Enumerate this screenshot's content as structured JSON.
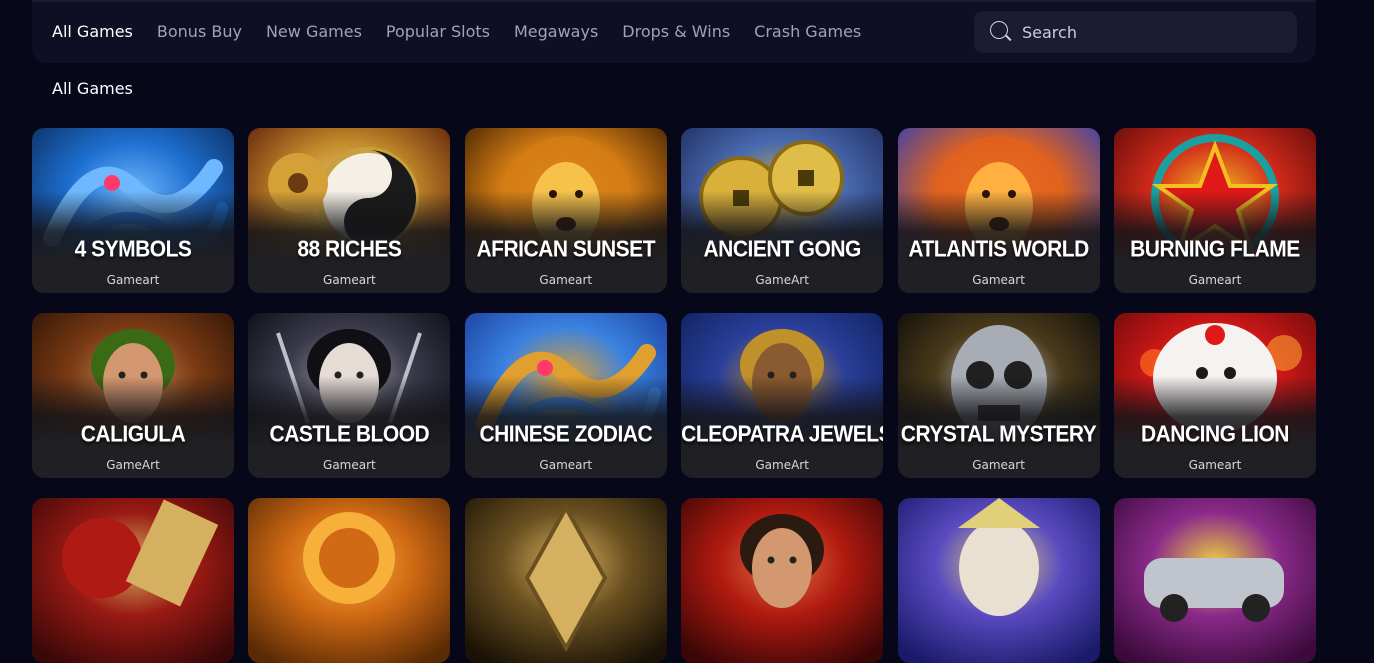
{
  "nav": {
    "items": [
      {
        "label": "All Games",
        "active": true
      },
      {
        "label": "Bonus Buy",
        "active": false
      },
      {
        "label": "New Games",
        "active": false
      },
      {
        "label": "Popular Slots",
        "active": false
      },
      {
        "label": "Megaways",
        "active": false
      },
      {
        "label": "Drops & Wins",
        "active": false
      },
      {
        "label": "Crash Games",
        "active": false
      }
    ]
  },
  "search": {
    "placeholder": "Search",
    "icon": "search-icon"
  },
  "section": {
    "title": "All Games"
  },
  "games": [
    {
      "title": "4 SYMBOLS",
      "provider": "Gameart",
      "colors": [
        "#0b2a5a",
        "#1e6fd0",
        "#6fb8ff"
      ],
      "motif": "dragon"
    },
    {
      "title": "88 RICHES",
      "provider": "Gameart",
      "colors": [
        "#5a1a08",
        "#c28a2a",
        "#f3d27a"
      ],
      "motif": "yinyang"
    },
    {
      "title": "AFRICAN SUNSET",
      "provider": "Gameart",
      "colors": [
        "#3a1c02",
        "#d47d14",
        "#f7c24a"
      ],
      "motif": "lion"
    },
    {
      "title": "ANCIENT GONG",
      "provider": "GameArt",
      "colors": [
        "#1d2a5a",
        "#4a6ab0",
        "#d9b03a"
      ],
      "motif": "coins"
    },
    {
      "title": "ATLANTIS WORLD",
      "provider": "Gameart",
      "colors": [
        "#2a3fb8",
        "#e0621e",
        "#ffb040"
      ],
      "motif": "lionfire"
    },
    {
      "title": "BURNING FLAME",
      "provider": "Gameart",
      "colors": [
        "#5a0a0a",
        "#d22a1a",
        "#f2c020"
      ],
      "motif": "star"
    },
    {
      "title": "CALIGULA",
      "provider": "GameArt",
      "colors": [
        "#2a1206",
        "#7a3a14",
        "#c48a52"
      ],
      "motif": "face"
    },
    {
      "title": "CASTLE BLOOD",
      "provider": "Gameart",
      "colors": [
        "#0a0a12",
        "#3a3a4a",
        "#9a9aa8"
      ],
      "motif": "vampire"
    },
    {
      "title": "CHINESE ZODIAC",
      "provider": "Gameart",
      "colors": [
        "#1a3a9a",
        "#3a82e0",
        "#e0a030"
      ],
      "motif": "dragon2"
    },
    {
      "title": "CLEOPATRA JEWELS",
      "provider": "GameArt",
      "colors": [
        "#0e1f5a",
        "#2a3f9a",
        "#c0902a"
      ],
      "motif": "cleo"
    },
    {
      "title": "CRYSTAL MYSTERY",
      "provider": "Gameart",
      "colors": [
        "#0a0a0a",
        "#4a3a1a",
        "#c0c4cc"
      ],
      "motif": "skull"
    },
    {
      "title": "DANCING LION",
      "provider": "Gameart",
      "colors": [
        "#6a0a0a",
        "#d01818",
        "#f4f0ee"
      ],
      "motif": "dlion"
    },
    {
      "title": "",
      "provider": "",
      "colors": [
        "#3a0808",
        "#9a1a14",
        "#d4b060"
      ],
      "motif": "seal"
    },
    {
      "title": "",
      "provider": "",
      "colors": [
        "#5a2a04",
        "#d06a14",
        "#f7b03a"
      ],
      "motif": "sun"
    },
    {
      "title": "",
      "provider": "",
      "colors": [
        "#1a1206",
        "#6a5020",
        "#d4b060"
      ],
      "motif": "gold"
    },
    {
      "title": "",
      "provider": "",
      "colors": [
        "#3a0606",
        "#b01a10",
        "#e07040"
      ],
      "motif": "man"
    },
    {
      "title": "",
      "provider": "",
      "colors": [
        "#1a1a6a",
        "#5a4ac0",
        "#e0d07a"
      ],
      "motif": "wizard"
    },
    {
      "title": "",
      "provider": "",
      "colors": [
        "#3a0a3a",
        "#8a2a8a",
        "#f0d040"
      ],
      "motif": "car"
    }
  ]
}
